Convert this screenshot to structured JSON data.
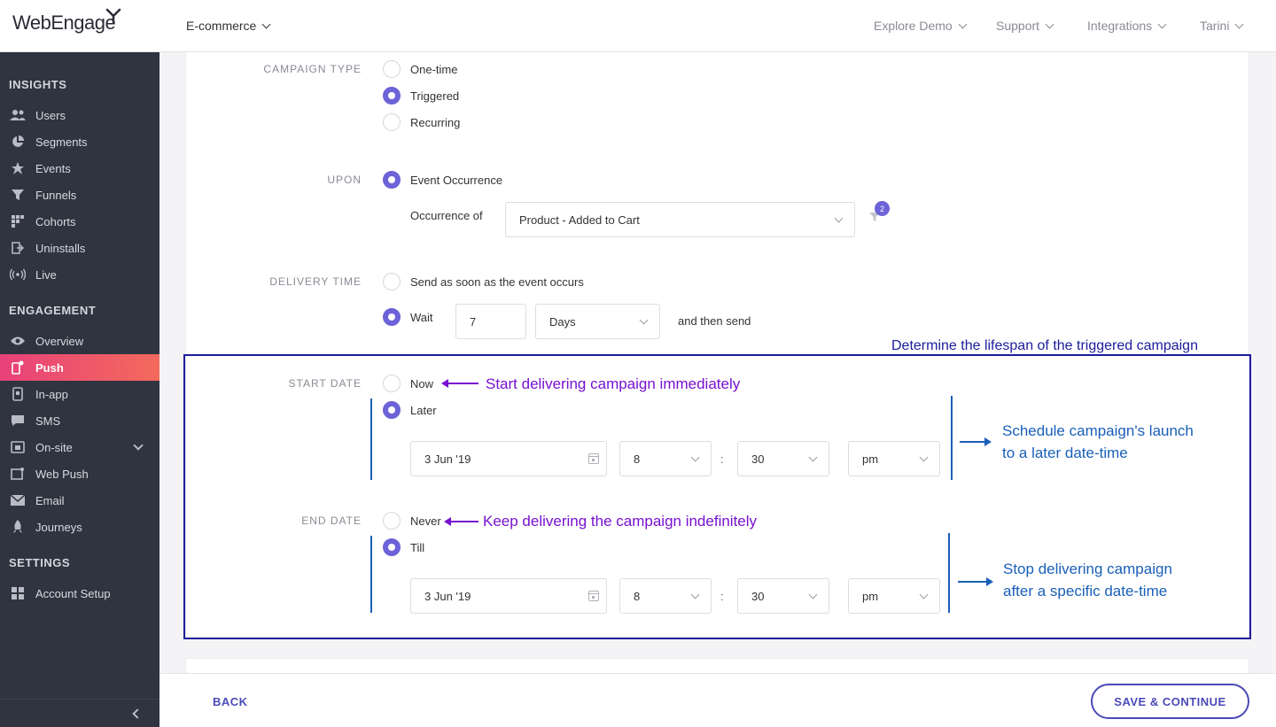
{
  "app": {
    "logo_text": "WebEngage"
  },
  "topnav": {
    "project": "E-commerce",
    "items": [
      "Explore Demo",
      "Support",
      "Integrations",
      "Tarini"
    ]
  },
  "sidebar": {
    "sections": {
      "insights": "INSIGHTS",
      "engagement": "ENGAGEMENT",
      "settings": "SETTINGS"
    },
    "insights_items": [
      "Users",
      "Segments",
      "Events",
      "Funnels",
      "Cohorts",
      "Uninstalls",
      "Live"
    ],
    "engagement_items": [
      "Overview",
      "Push",
      "In-app",
      "SMS",
      "On-site",
      "Web Push",
      "Email",
      "Journeys"
    ],
    "settings_items": [
      "Account Setup"
    ],
    "active": "Push"
  },
  "form": {
    "campaign_type": {
      "label": "CAMPAIGN TYPE",
      "options": [
        "One-time",
        "Triggered",
        "Recurring"
      ],
      "selected": "Triggered"
    },
    "upon": {
      "label": "UPON",
      "option": "Event Occurrence",
      "occurrence_label": "Occurrence of",
      "occurrence_value": "Product - Added to Cart",
      "filter_count": "2"
    },
    "delivery_time": {
      "label": "DELIVERY TIME",
      "option_now": "Send as soon as the event occurs",
      "option_wait": "Wait",
      "wait_value": "7",
      "wait_unit": "Days",
      "suffix": "and then send"
    },
    "start_date": {
      "label": "START DATE",
      "option_now": "Now",
      "option_later": "Later",
      "date": "3 Jun '19",
      "hour": "8",
      "minute": "30",
      "ampm": "pm",
      "separator": ":"
    },
    "end_date": {
      "label": "END DATE",
      "option_never": "Never",
      "option_till": "Till",
      "date": "3 Jun '19",
      "hour": "8",
      "minute": "30",
      "ampm": "pm",
      "separator": ":"
    }
  },
  "annotations": {
    "box_title": "Determine the lifespan of the triggered campaign",
    "start_now": "Start delivering campaign immediately",
    "start_later_1": "Schedule campaign's launch",
    "start_later_2": "to a later date-time",
    "end_never": "Keep delivering the campaign indefinitely",
    "end_till_1": "Stop delivering campaign",
    "end_till_2": "after a specific date-time"
  },
  "footer": {
    "back": "BACK",
    "save": "SAVE & CONTINUE"
  },
  "colors": {
    "accent": "#6c63d8",
    "sidebar_bg": "#2f3440",
    "active_gradient_start": "#e8417a",
    "active_gradient_end": "#f36a5c",
    "annotation_purple": "#7711d0",
    "annotation_blue": "#1a5fb8",
    "annotation_box": "#1c1c9c",
    "button": "#4a4ab8"
  }
}
